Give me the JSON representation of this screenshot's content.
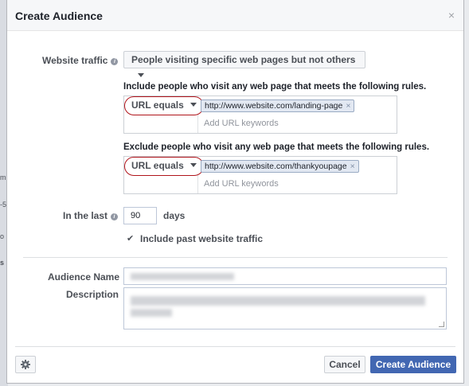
{
  "background": {
    "fragments": [
      "m",
      "-5",
      "o",
      "s"
    ]
  },
  "dialog": {
    "title": "Create Audience",
    "close_icon": "×"
  },
  "form": {
    "website_traffic_label": "Website traffic",
    "website_traffic_value": "People visiting specific web pages but not others",
    "include_rule": {
      "text": "Include people who visit any web page that meets the following rules.",
      "match_type": "URL equals",
      "token": "http://www.website.com/landing-page",
      "keywords_placeholder": "Add URL keywords"
    },
    "exclude_rule": {
      "text": "Exclude people who visit any web page that meets the following rules.",
      "match_type": "URL equals",
      "token": "http://www.website.com/thankyoupage",
      "keywords_placeholder": "Add URL keywords"
    },
    "in_the_last_label": "In the last",
    "days_value": "90",
    "days_label": "days",
    "include_past_checked": true,
    "include_past_label": "Include past website traffic",
    "audience_name_label": "Audience Name",
    "description_label": "Description"
  },
  "footer": {
    "cancel_label": "Cancel",
    "create_label": "Create Audience"
  },
  "colors": {
    "primary": "#4267b2",
    "highlight_circle": "#b0141b"
  }
}
